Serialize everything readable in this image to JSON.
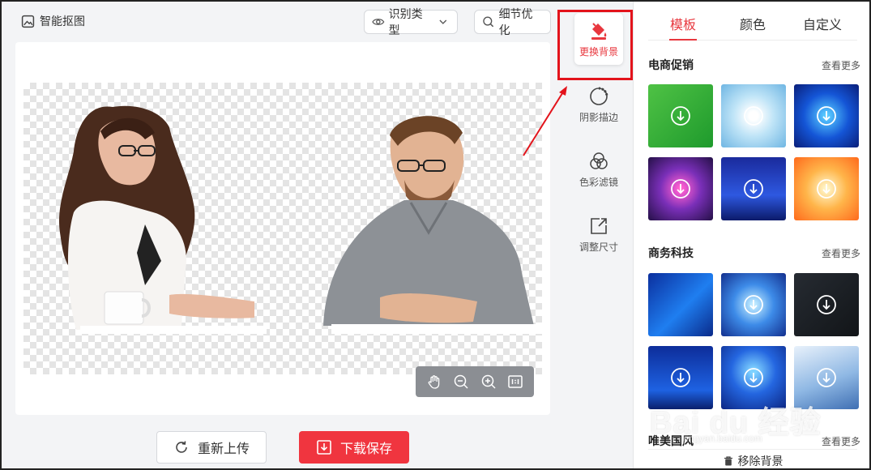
{
  "toolbar": {
    "app_title": "智能抠图",
    "detect_type": "识别类型",
    "detail_optimize": "细节优化"
  },
  "actions": {
    "reupload": "重新上传",
    "download": "下载保存"
  },
  "tools": [
    {
      "label": "更换背景",
      "icon": "paint-bucket-icon",
      "active": true
    },
    {
      "label": "阴影描边",
      "icon": "shadow-circle-icon"
    },
    {
      "label": "色彩滤镜",
      "icon": "color-filter-icon"
    },
    {
      "label": "调整尺寸",
      "icon": "resize-icon"
    }
  ],
  "panel": {
    "tabs": [
      "模板",
      "颜色",
      "自定义"
    ],
    "active_tab": "模板",
    "sections": [
      {
        "title": "电商促销",
        "more": "查看更多"
      },
      {
        "title": "商务科技",
        "more": "查看更多"
      },
      {
        "title": "唯美国风",
        "more": "查看更多"
      }
    ],
    "remove_bg": "移除背景"
  },
  "watermark": {
    "main": "Bai du 经验",
    "sub": "jingyan.baidu.com"
  },
  "colors": {
    "accent": "#e8373e",
    "download_button": "#f0353f",
    "highlight": "#e3131b"
  }
}
